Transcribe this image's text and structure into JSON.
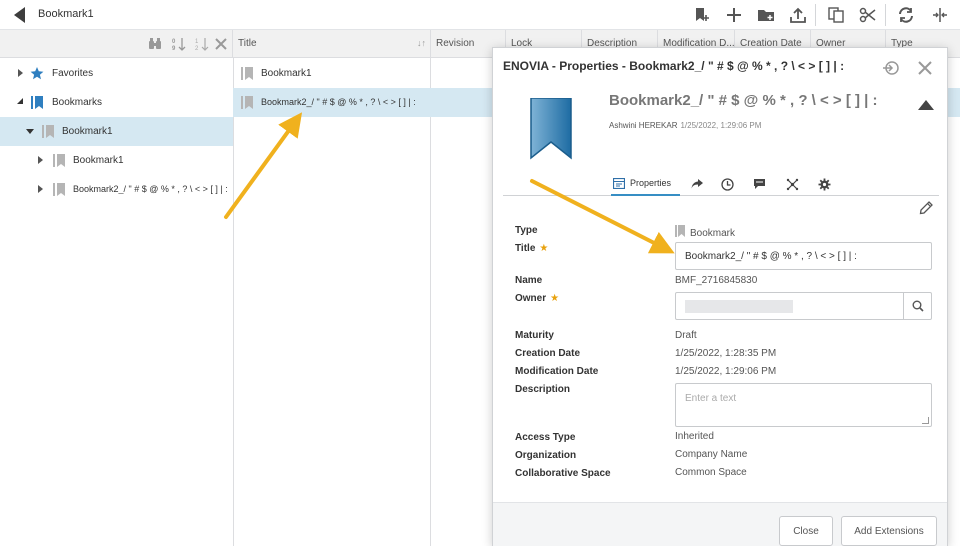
{
  "app": {
    "title": "Bookmark1"
  },
  "toolbar": {
    "icons": [
      "bookmark-add-icon",
      "plus-icon",
      "folder-add-icon",
      "upload-icon",
      "copy-icon",
      "cut-icon",
      "refresh-icon",
      "split-view-icon"
    ]
  },
  "tree": {
    "items": [
      {
        "label": "Favorites",
        "icon": "star-icon",
        "expanded": false
      },
      {
        "label": "Bookmarks",
        "icon": "bookmark-folder-icon",
        "expanded": true
      },
      {
        "label": "Bookmark1",
        "icon": "bookmark-icon",
        "expanded": true,
        "selected": true
      },
      {
        "label": "Bookmark1",
        "icon": "bookmark-icon",
        "expanded": false
      },
      {
        "label": "Bookmark2_/ \" # $ @ % * , ? \\ < > [ ] | :",
        "icon": "bookmark-icon",
        "expanded": false
      }
    ]
  },
  "grid": {
    "columns": [
      "Title",
      "Revision",
      "Lock",
      "Description",
      "Modification D...",
      "Creation Date",
      "Owner",
      "Type"
    ],
    "rows": [
      {
        "title": "Bookmark1"
      },
      {
        "title": "Bookmark2_/ \" # $ @ % * , ? \\ < > [ ] | :",
        "selected": true
      }
    ]
  },
  "panel": {
    "window_title": "ENOVIA - Properties - Bookmark2_/ \" # $ @ % * , ? \\ < > [ ] | :",
    "object_title": "Bookmark2_/ \" # $ @ % * , ? \\ < > [ ] | :",
    "author": "Ashwini HEREKAR",
    "author_date": "1/25/2022, 1:29:06 PM",
    "tabs": [
      {
        "label": "Properties",
        "icon": "properties-icon",
        "active": true
      },
      {
        "label": "",
        "icon": "share-icon"
      },
      {
        "label": "",
        "icon": "history-icon"
      },
      {
        "label": "",
        "icon": "comment-icon"
      },
      {
        "label": "",
        "icon": "relations-icon"
      },
      {
        "label": "",
        "icon": "settings-icon"
      }
    ],
    "fields": {
      "type": {
        "label": "Type",
        "value": "Bookmark"
      },
      "title": {
        "label": "Title",
        "value": "Bookmark2_/ \" # $ @ % * , ? \\ < > [ ] | :",
        "required": "★"
      },
      "name": {
        "label": "Name",
        "value": "BMF_2716845830"
      },
      "owner": {
        "label": "Owner",
        "required": "★"
      },
      "maturity": {
        "label": "Maturity",
        "value": "Draft"
      },
      "creation_date": {
        "label": "Creation Date",
        "value": "1/25/2022, 1:28:35 PM"
      },
      "modification_date": {
        "label": "Modification Date",
        "value": "1/25/2022, 1:29:06 PM"
      },
      "description": {
        "label": "Description",
        "placeholder": "Enter a text"
      },
      "access_type": {
        "label": "Access Type",
        "value": "Inherited"
      },
      "organization": {
        "label": "Organization",
        "value": "Company Name"
      },
      "collaborative_space": {
        "label": "Collaborative Space",
        "value": "Common Space"
      }
    },
    "buttons": {
      "close": "Close",
      "add_extensions": "Add Extensions"
    }
  },
  "colors": {
    "accent": "#368ec4",
    "selection": "#d5e8f2",
    "arrow": "#f0b11e",
    "required": "#e8a20f"
  }
}
